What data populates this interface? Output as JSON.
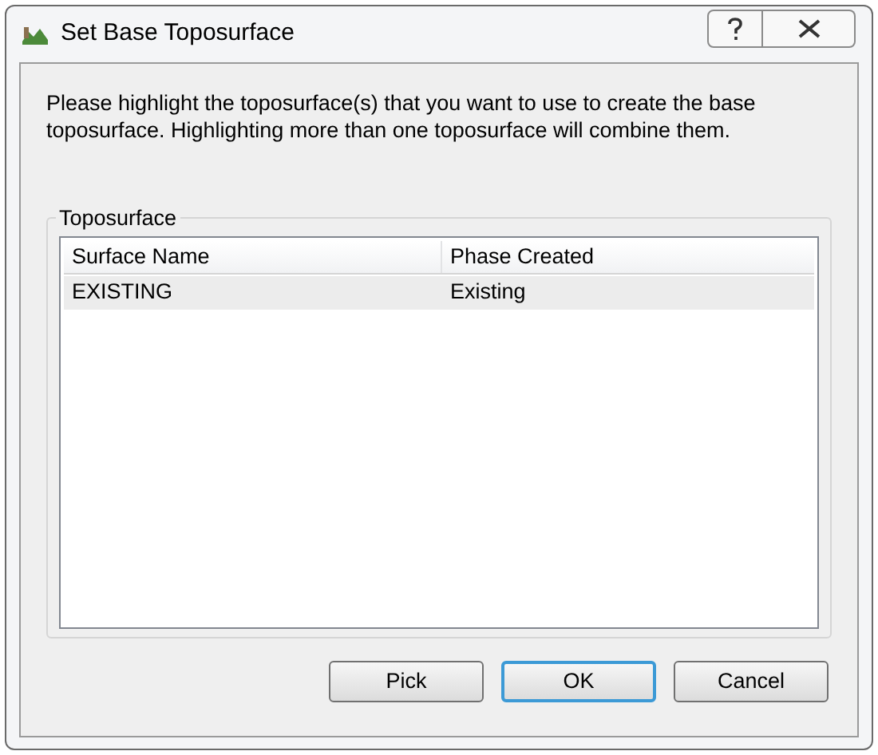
{
  "window": {
    "title": "Set Base Toposurface"
  },
  "message": "Please highlight the toposurface(s) that you want to use to create the base toposurface. Highlighting more than one toposurface will combine them.",
  "group": {
    "title": "Toposurface"
  },
  "table": {
    "columns": [
      "Surface Name",
      "Phase Created"
    ],
    "rows": [
      {
        "cells": [
          "EXISTING",
          "Existing"
        ],
        "selected": true
      }
    ]
  },
  "buttons": [
    {
      "label": "Pick",
      "default": false
    },
    {
      "label": "OK",
      "default": true
    },
    {
      "label": "Cancel",
      "default": false
    }
  ]
}
